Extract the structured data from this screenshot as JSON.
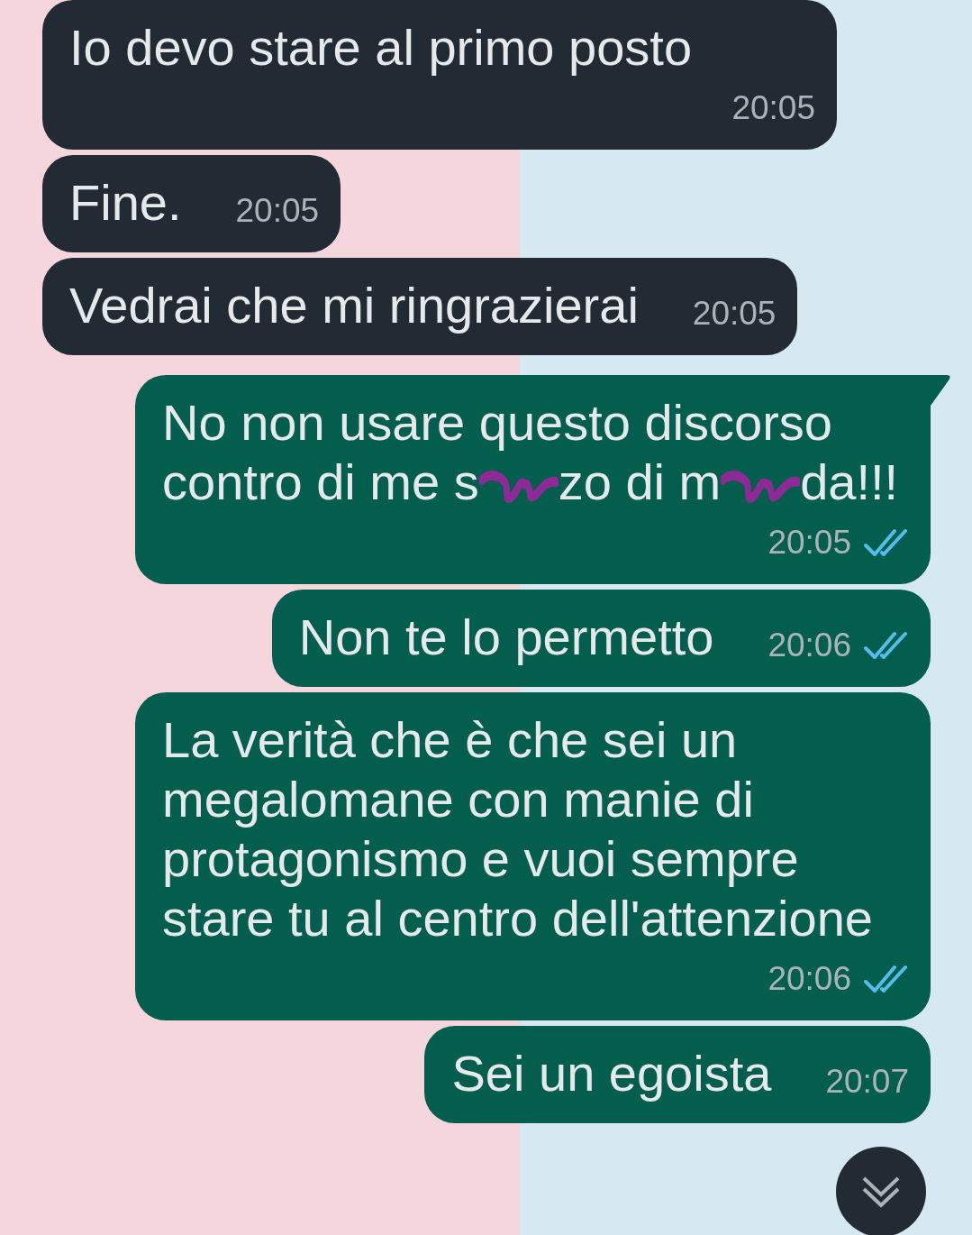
{
  "messages": [
    {
      "kind": "incoming",
      "segments": [
        {
          "kind": "text",
          "text": "Io devo stare al primo posto"
        }
      ],
      "time": "20:05"
    },
    {
      "kind": "incoming",
      "segments": [
        {
          "kind": "text",
          "text": "Fine."
        }
      ],
      "time": "20:05"
    },
    {
      "kind": "incoming",
      "segments": [
        {
          "kind": "text",
          "text": "Vedrai che mi ringrazierai"
        }
      ],
      "time": "20:05"
    },
    {
      "kind": "outgoing",
      "segments": [
        {
          "kind": "text",
          "text": "No non usare questo discorso contro di me s"
        },
        {
          "kind": "scribble"
        },
        {
          "kind": "text",
          "text": "zo di m"
        },
        {
          "kind": "scribble"
        },
        {
          "kind": "text",
          "text": "da!!!"
        }
      ],
      "time": "20:05",
      "read": true,
      "tail": true
    },
    {
      "kind": "outgoing",
      "segments": [
        {
          "kind": "text",
          "text": "Non te lo permetto"
        }
      ],
      "time": "20:06",
      "read": true
    },
    {
      "kind": "outgoing",
      "segments": [
        {
          "kind": "text",
          "text": "La verità che è che sei un megalomane con manie di protagonismo e vuoi sempre stare tu al centro dell'attenzione"
        }
      ],
      "time": "20:06",
      "read": true
    },
    {
      "kind": "outgoing",
      "segments": [
        {
          "kind": "text",
          "text": "Sei un egoista"
        }
      ],
      "time": "20:07"
    }
  ]
}
